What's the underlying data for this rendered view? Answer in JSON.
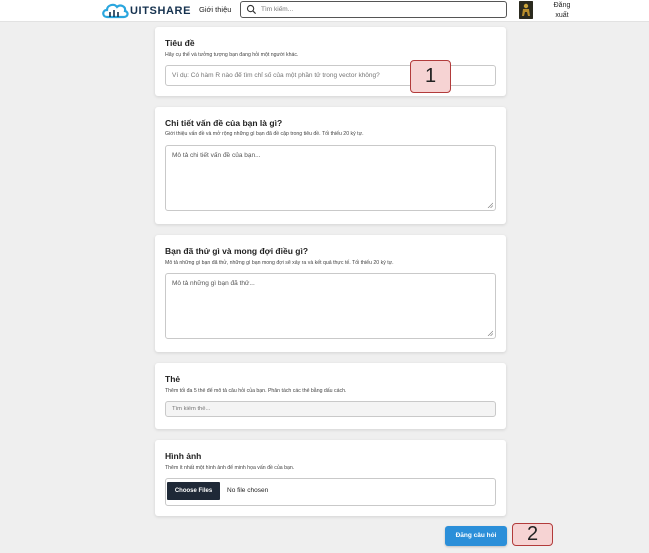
{
  "header": {
    "brand": "UITSHARE",
    "nav_about": "Giới thiệu",
    "search_placeholder": "Tìm kiếm...",
    "logout_line1": "Đăng",
    "logout_line2": "xuất"
  },
  "form": {
    "title_section": {
      "heading": "Tiêu đề",
      "description": "Hãy cụ thể và tưởng tượng bạn đang hỏi một người khác.",
      "placeholder": "Ví dụ: Có hàm R nào để tìm chỉ số của một phần tử trong vector không?"
    },
    "details_section": {
      "heading": "Chi tiết vấn đề của bạn là gì?",
      "description": "Giới thiệu vấn đề và mở rộng những gì bạn đã đề cập trong tiêu đề. Tối thiểu 20 ký tự.",
      "placeholder": "Mô tả chi tiết vấn đề của bạn..."
    },
    "tried_section": {
      "heading": "Bạn đã thử gì và mong đợi điều gì?",
      "description": "Mô tả những gì bạn đã thử, những gì bạn mong đợi sẽ xảy ra và kết quả thực tế. Tối thiểu 20 ký tự.",
      "placeholder": "Mô tả những gì bạn đã thử..."
    },
    "tags_section": {
      "heading": "Thẻ",
      "description": "Thêm tối đa 5 thẻ để mô tả câu hỏi của bạn. Phân tách các thẻ bằng dấu cách.",
      "placeholder": "Tìm kiếm thẻ..."
    },
    "image_section": {
      "heading": "Hình ảnh",
      "description": "Thêm ít nhất một hình ảnh để minh họa vấn đề của bạn.",
      "choose_label": "Choose Files",
      "no_file_text": "No file chosen"
    },
    "submit_label": "Đăng câu hỏi"
  },
  "markers": {
    "first": "1",
    "second": "2"
  },
  "colors": {
    "accent": "#2b8fd9",
    "brand": "#16324f",
    "marker_fill": "#f6d3d3",
    "marker_border": "#b23b3b"
  }
}
